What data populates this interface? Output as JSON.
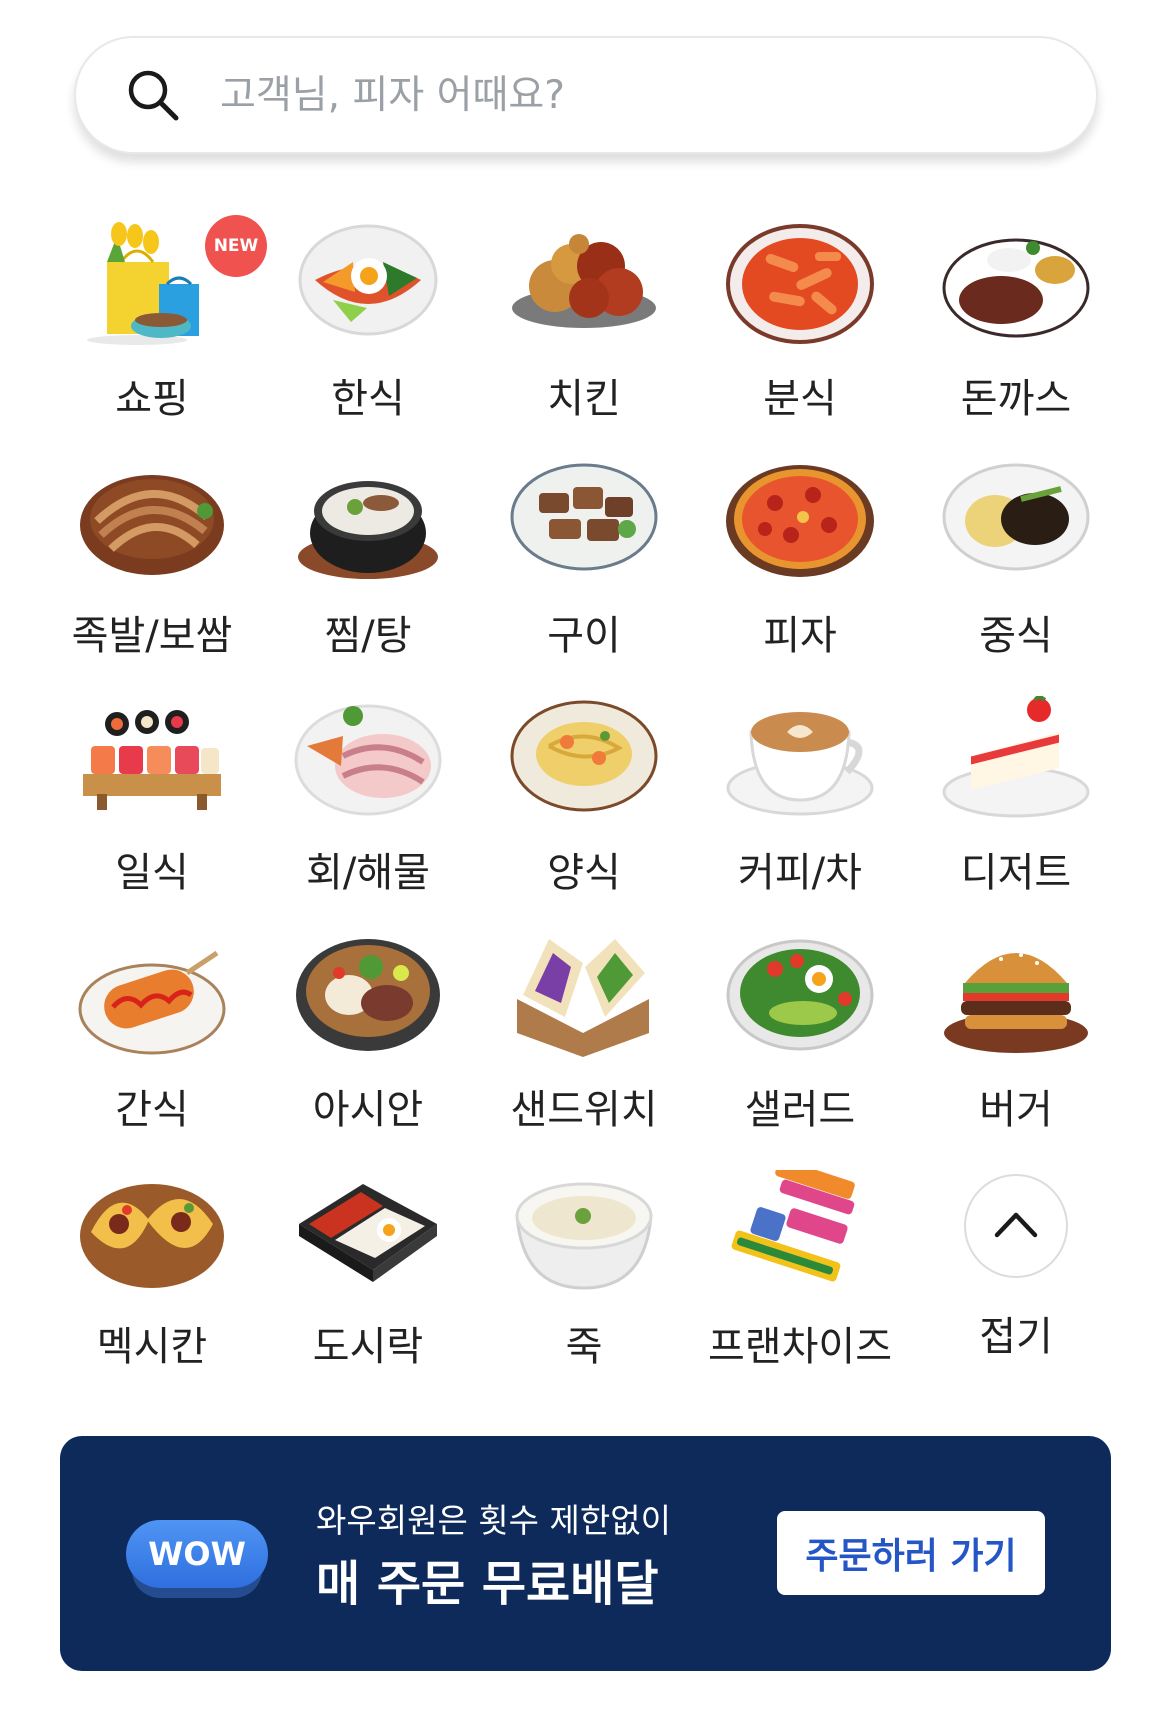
{
  "search": {
    "placeholder": "고객님, 피자 어때요?",
    "icon": "search-icon"
  },
  "categories": [
    {
      "label": "쇼핑",
      "icon": "shopping-bag-icon",
      "badge": "NEW"
    },
    {
      "label": "한식",
      "icon": "bibimbap-icon"
    },
    {
      "label": "치킨",
      "icon": "fried-chicken-icon"
    },
    {
      "label": "분식",
      "icon": "tteokbokki-icon"
    },
    {
      "label": "돈까스",
      "icon": "tonkatsu-icon"
    },
    {
      "label": "족발/보쌈",
      "icon": "jokbal-icon"
    },
    {
      "label": "찜/탕",
      "icon": "stew-pot-icon"
    },
    {
      "label": "구이",
      "icon": "grilled-meat-icon"
    },
    {
      "label": "피자",
      "icon": "pizza-icon"
    },
    {
      "label": "중식",
      "icon": "jajangmyeon-icon"
    },
    {
      "label": "일식",
      "icon": "sushi-icon"
    },
    {
      "label": "회/해물",
      "icon": "sashimi-icon"
    },
    {
      "label": "양식",
      "icon": "pasta-icon"
    },
    {
      "label": "커피/차",
      "icon": "coffee-cup-icon"
    },
    {
      "label": "디저트",
      "icon": "cake-icon"
    },
    {
      "label": "간식",
      "icon": "corn-dog-icon"
    },
    {
      "label": "아시안",
      "icon": "pho-bowl-icon"
    },
    {
      "label": "샌드위치",
      "icon": "sandwich-icon"
    },
    {
      "label": "샐러드",
      "icon": "salad-icon"
    },
    {
      "label": "버거",
      "icon": "burger-icon"
    },
    {
      "label": "멕시칸",
      "icon": "taco-icon"
    },
    {
      "label": "도시락",
      "icon": "lunchbox-icon"
    },
    {
      "label": "죽",
      "icon": "porridge-icon"
    },
    {
      "label": "프랜차이즈",
      "icon": "franchise-logos-icon"
    },
    {
      "label": "접기",
      "icon": "chevron-up-icon"
    }
  ],
  "banner": {
    "badge": "WOW",
    "line1": "와우회원은 횟수 제한없이",
    "line2": "매 주문 무료배달",
    "cta": "주문하러 가기"
  }
}
